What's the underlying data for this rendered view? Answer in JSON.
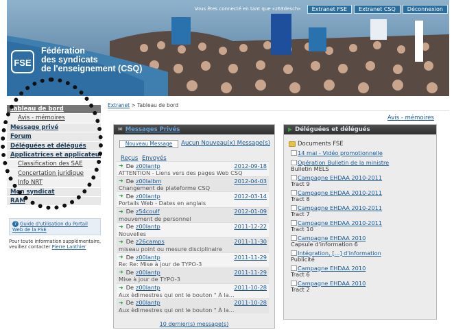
{
  "header": {
    "connected_text": "Vous êtes connecté en tant que «z63desch»",
    "buttons": [
      "Extranet FSE",
      "Extranet CSQ",
      "Déconnexion"
    ],
    "brand_line1": "Fédération",
    "brand_line2": "des syndicats",
    "brand_line3": "de l'enseignement (CSQ)",
    "logo_text": "FSE"
  },
  "breadcrumb": {
    "link": "Extranet",
    "sep": " > ",
    "current": "Tableau de bord"
  },
  "avis_link": "Avis - mémoires",
  "sidebar": {
    "items": [
      {
        "label": "Tableau de bord",
        "type": "active"
      },
      {
        "label": "Avis - mémoires",
        "type": "sub"
      },
      {
        "label": "Message privé",
        "type": "main"
      },
      {
        "label": "Forum",
        "type": "main"
      },
      {
        "label": "Déléguées et délégués",
        "type": "main"
      },
      {
        "label": "Applicatrices et applicateurs",
        "type": "main"
      },
      {
        "label": "Classification des SAE",
        "type": "sub"
      },
      {
        "label": "Concertation juridique",
        "type": "sub"
      },
      {
        "label": "Info NRT",
        "type": "sub"
      },
      {
        "label": "Mon syndicat",
        "type": "main"
      },
      {
        "label": "RAM",
        "type": "main"
      }
    ],
    "guide_link": "Guide d'utilisation du Portail Web de la FSE",
    "contact_text": "Pour toute information supplémentaire, veuillez contacter ",
    "contact_name": "Pierre Lanthier"
  },
  "messages_panel": {
    "title": "Messages Privés",
    "new_button": "Nouveau Message",
    "none_new": "Aucun Nouveau(x) Message(s)",
    "tab_received": "Reçus",
    "tab_sent": "Envoyés",
    "from_label": "De",
    "items": [
      {
        "from": "z00lantp",
        "date": "2012-09-18",
        "subject": "ATTENTION - Liens vers des pages Web CSQ"
      },
      {
        "from": "z00lalbm",
        "date": "2012-04-03",
        "subject": "Changement de plateforme CSQ"
      },
      {
        "from": "z00lantp",
        "date": "2012-03-14",
        "subject": "Portails Web - Dates en anglais"
      },
      {
        "from": "z54coulf",
        "date": "2012-01-09",
        "subject": "mouvement de personnel"
      },
      {
        "from": "z00lantp",
        "date": "2011-12-22",
        "subject": "Nouvelles"
      },
      {
        "from": "z26camps",
        "date": "2011-11-30",
        "subject": "miseau point ou mesure disciplinaire"
      },
      {
        "from": "z00lantp",
        "date": "2011-11-29",
        "subject": "Re: Re: Mise à jour de TYPO-3"
      },
      {
        "from": "z00lantp",
        "date": "2011-11-29",
        "subject": "Mise à jour de TYPO-3"
      },
      {
        "from": "z00lantp",
        "date": "2011-10-28",
        "subject": "Aux èdimestres qui ont le bouton \" À la..."
      },
      {
        "from": "z00lantp",
        "date": "2011-10-28",
        "subject": "Aux èdimestres qui ont le bouton \" À la..."
      }
    ],
    "more_link": "10 dernier(s) message(s)"
  },
  "delegates_panel": {
    "title": "Déléguées et délégués",
    "docs_title": "Documents FSE",
    "docs": [
      {
        "link": "14 mai - Vidéo promotionnelle",
        "desc": ""
      },
      {
        "link": "Opération Bulletin de la ministre",
        "desc": "Bulletin MELS"
      },
      {
        "link": "Campagne EHDAA 2010-2011",
        "desc": "Tract 9"
      },
      {
        "link": "Campagne EHDAA 2010-2011",
        "desc": "Tract 8"
      },
      {
        "link": "Campagne EHDAA 2010-2011",
        "desc": "Tract 7"
      },
      {
        "link": "Campagne EHDAA 2010-2011",
        "desc": "Tract 10"
      },
      {
        "link": "Campagne EHDAA 2010",
        "desc": "Capsule d'information 6"
      },
      {
        "link": "Intégration, [...] d'information",
        "desc": "Publicité"
      },
      {
        "link": "Campagne EHDAA 2010",
        "desc": "Tract 6"
      },
      {
        "link": "Campagne EHDAA 2010",
        "desc": "Tract 2"
      }
    ]
  },
  "colors": {
    "sidebar_active": "#777777",
    "panel_header": "#3a3a3a",
    "link": "#1a5a96",
    "arrow": "#2d9b38"
  }
}
